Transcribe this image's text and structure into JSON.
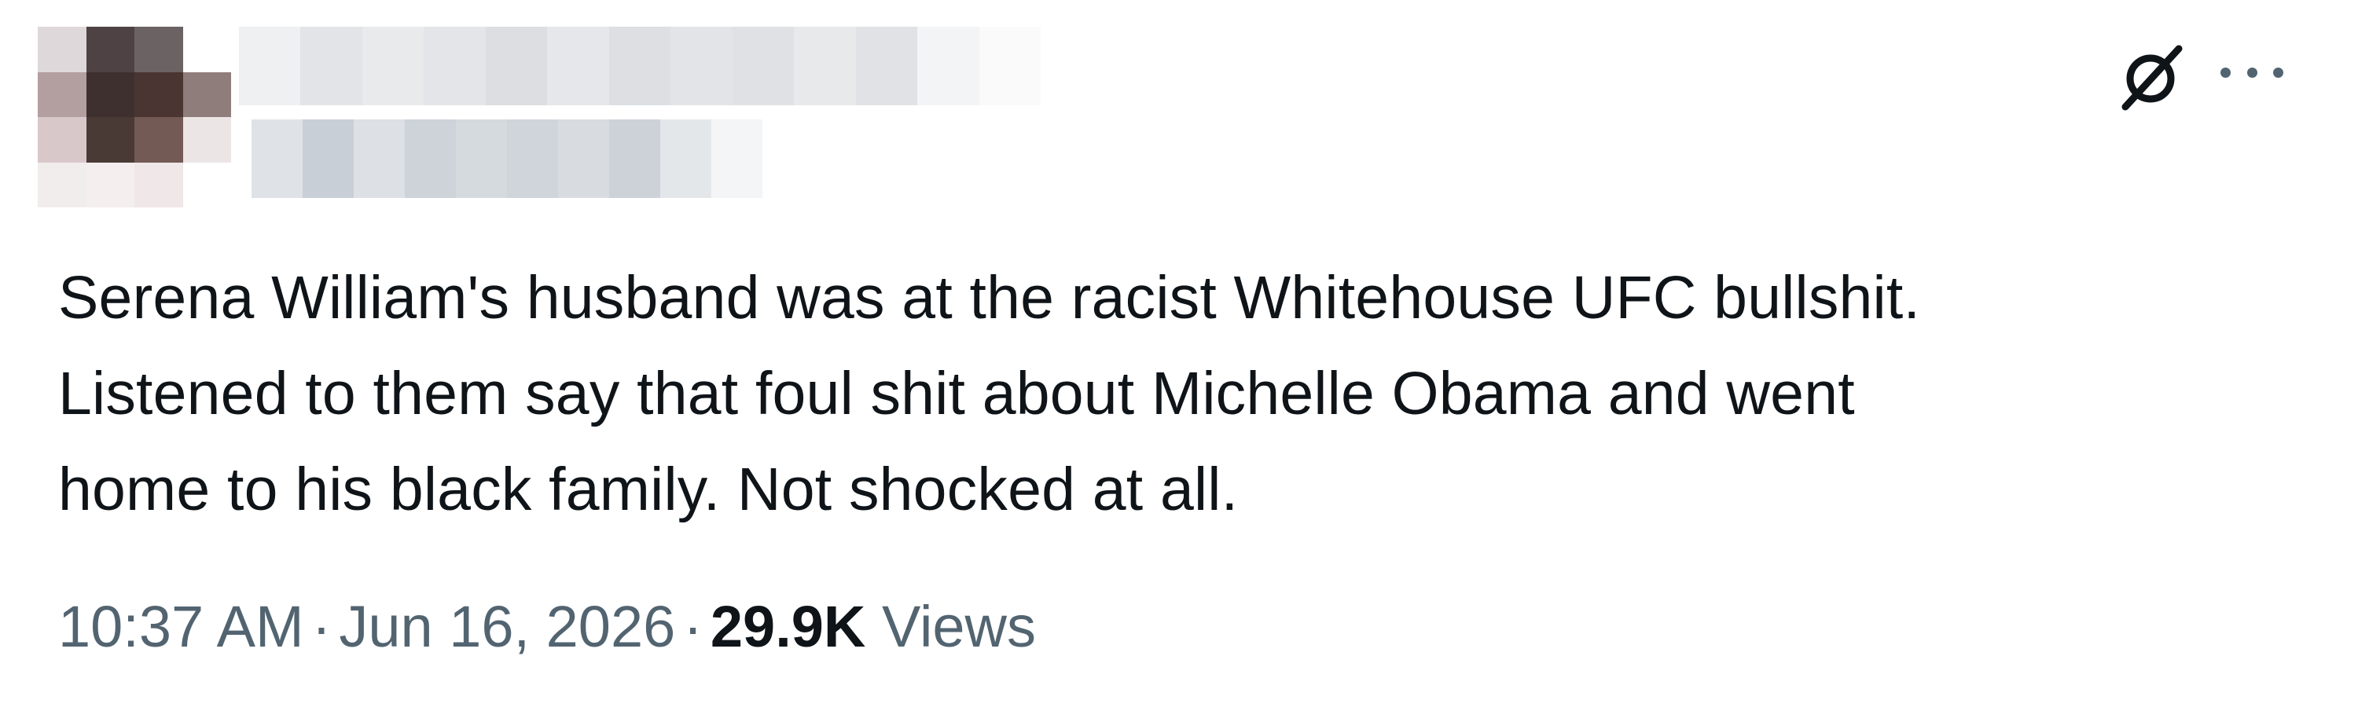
{
  "tweet": {
    "author": {
      "display_name": "",
      "handle": ""
    },
    "icons": {
      "grok": "grok-icon",
      "more": "more-options-icon"
    },
    "text_lines": [
      "Serena William's husband was at the racist Whitehouse UFC bullshit.",
      "Listened to them say that foul shit about Michelle Obama and went",
      "home to his black family. Not shocked at all."
    ],
    "meta": {
      "time": "10:37 AM",
      "separator": "·",
      "date": "Jun 16, 2026",
      "views_count": "29.9K",
      "views_label": "Views"
    },
    "colors": {
      "text_primary": "#0f1419",
      "text_secondary": "#536471",
      "background": "#ffffff"
    }
  }
}
